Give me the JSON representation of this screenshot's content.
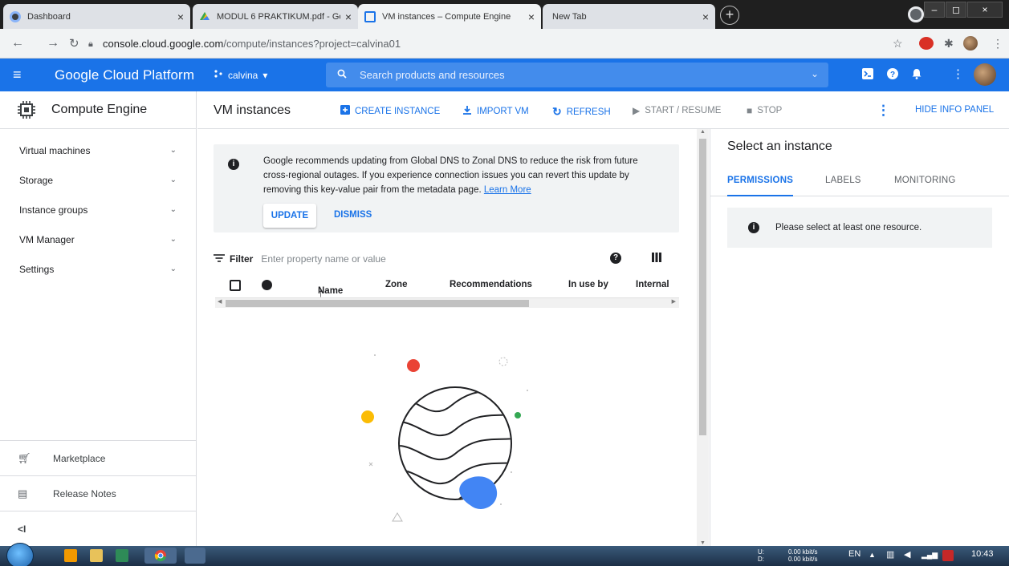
{
  "browser": {
    "tabs": [
      {
        "label": "Dashboard",
        "close": "×"
      },
      {
        "label": "MODUL 6 PRAKTIKUM.pdf - Goo",
        "close": "×"
      },
      {
        "label": "VM instances – Compute Engine",
        "close": "×"
      },
      {
        "label": "New Tab",
        "close": "×"
      }
    ],
    "newtab": "+",
    "window_buttons": {
      "minimize": "–",
      "maximize": "◻",
      "close": "×"
    },
    "url_host": "console.cloud.google.com",
    "url_path": "/compute/instances?project=calvina01"
  },
  "header": {
    "menu_icon": "≡",
    "brand": "Google Cloud Platform",
    "project": "calvina",
    "project_chevron": "▾",
    "search_placeholder": "Search products and resources",
    "search_chevron": "⌄"
  },
  "sidebar": {
    "title": "Compute Engine",
    "items": [
      {
        "label": "Virtual machines",
        "chev": "⌄"
      },
      {
        "label": "Storage",
        "chev": "⌄"
      },
      {
        "label": "Instance groups",
        "chev": "⌄"
      },
      {
        "label": "VM Manager",
        "chev": "⌄"
      },
      {
        "label": "Settings",
        "chev": "⌄"
      }
    ],
    "marketplace": "Marketplace",
    "release_notes": "Release Notes",
    "collapse": "<I"
  },
  "toolbar": {
    "title": "VM instances",
    "create": "CREATE INSTANCE",
    "import": "IMPORT VM",
    "refresh": "REFRESH",
    "start": "START / RESUME",
    "stop": "STOP",
    "hide_panel": "HIDE INFO PANEL"
  },
  "banner": {
    "message": "Google recommends updating from Global DNS to Zonal DNS to reduce the risk from future cross-regional outages. If you experience connection issues you can revert this update by removing this key-value pair from the metadata page.",
    "learn_more": "Learn More",
    "update": "UPDATE",
    "dismiss": "DISMISS"
  },
  "filter": {
    "label": "Filter",
    "placeholder": "Enter property name or value"
  },
  "table": {
    "columns": [
      "Name",
      "Zone",
      "Recommendations",
      "In use by",
      "Internal"
    ],
    "sort_arrow": "↑"
  },
  "info_panel": {
    "title": "Select an instance",
    "tabs": [
      "PERMISSIONS",
      "LABELS",
      "MONITORING"
    ],
    "note": "Please select at least one resource."
  },
  "taskbar": {
    "net_up_label": "U:",
    "net_down_label": "D:",
    "net_up": "0.00 kbit/s",
    "net_down": "0.00 kbit/s",
    "lang": "EN",
    "time": "10:43"
  },
  "colors": {
    "primary": "#1a73e8",
    "illustration_red": "#ea4335",
    "illustration_yellow": "#fbbc04",
    "illustration_green": "#34a853",
    "illustration_blue": "#4285f4"
  }
}
